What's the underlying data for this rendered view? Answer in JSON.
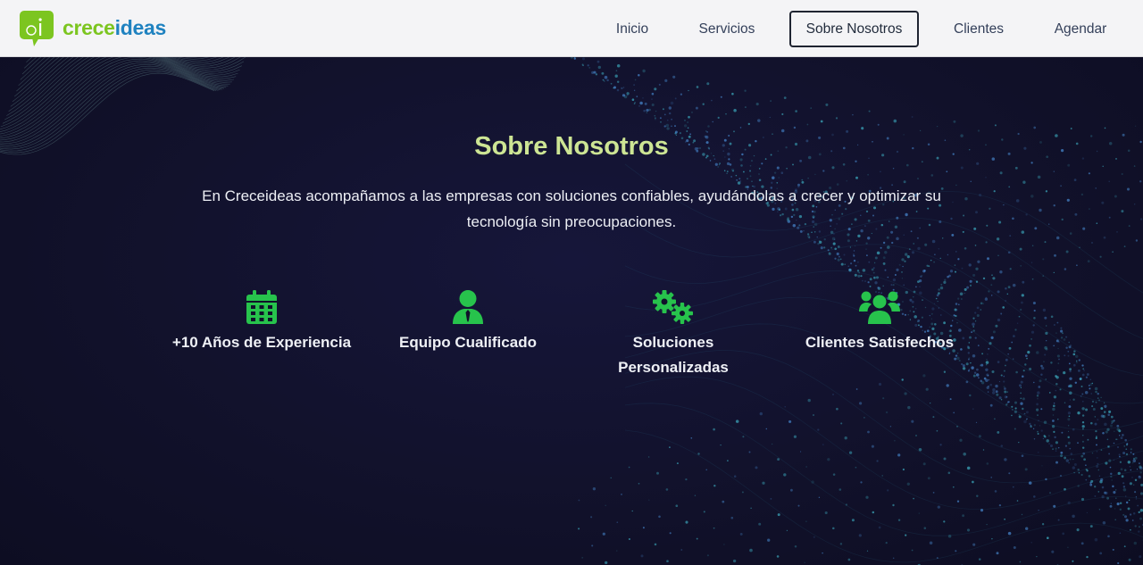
{
  "brand": {
    "part1": "crece",
    "part2": "ideas"
  },
  "nav": {
    "items": [
      {
        "label": "Inicio"
      },
      {
        "label": "Servicios"
      },
      {
        "label": "Sobre Nosotros"
      },
      {
        "label": "Clientes"
      },
      {
        "label": "Agendar"
      }
    ],
    "active_index": 2
  },
  "about": {
    "title": "Sobre Nosotros",
    "description": "En Creceideas acompañamos a las empresas con soluciones confiables, ayudándolas a crecer y optimizar su tecnología sin preocupaciones.",
    "features": [
      {
        "icon": "calendar-icon",
        "label": "+10 Años de Experiencia"
      },
      {
        "icon": "user-tie-icon",
        "label": "Equipo Cualificado"
      },
      {
        "icon": "gears-icon",
        "label": "Soluciones Personalizadas"
      },
      {
        "icon": "users-icon",
        "label": "Clientes Satisfechos"
      }
    ]
  },
  "colors": {
    "accent_green": "#27c34c",
    "title_green": "#cde594",
    "logo_green": "#7cc520",
    "logo_blue": "#1f82c0",
    "background": "#11112a"
  }
}
